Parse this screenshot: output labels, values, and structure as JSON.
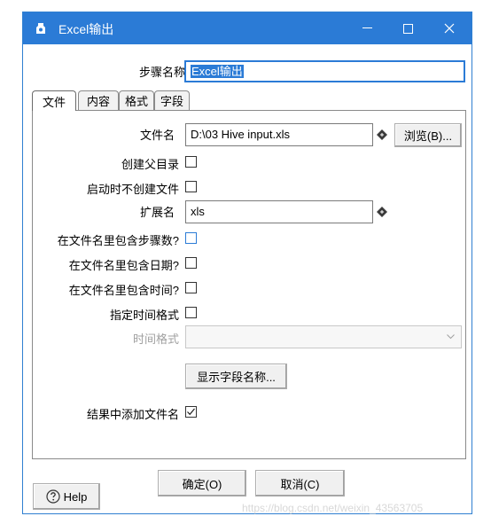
{
  "window": {
    "title": "Excel输出",
    "minimize_glyph": "—",
    "maximize_glyph": "☐",
    "close_glyph": "✕",
    "titlebar_color": "#2b7bd6"
  },
  "step": {
    "label": "步骤名称",
    "value": "Excel输出"
  },
  "tabs": [
    {
      "label": "文件",
      "active": true
    },
    {
      "label": "内容",
      "active": false
    },
    {
      "label": "格式",
      "active": false
    },
    {
      "label": "字段",
      "active": false
    }
  ],
  "file_tab": {
    "filename_label": "文件名",
    "filename_value": "D:\\03 Hive input.xls",
    "browse_button": "浏览(B)...",
    "create_parent_label": "创建父目录",
    "create_parent_checked": false,
    "no_create_on_start_label": "启动时不创建文件",
    "no_create_on_start_checked": false,
    "extension_label": "扩展名",
    "extension_value": "xls",
    "include_stepnr_label": "在文件名里包含步骤数?",
    "include_stepnr_checked": false,
    "include_date_label": "在文件名里包含日期?",
    "include_date_checked": false,
    "include_time_label": "在文件名里包含时间?",
    "include_time_checked": false,
    "specify_format_label": "指定时间格式",
    "specify_format_checked": false,
    "date_format_label": "时间格式",
    "date_format_value": "",
    "show_fields_button": "显示字段名称...",
    "add_to_result_label": "结果中添加文件名",
    "add_to_result_checked": true
  },
  "footer": {
    "help_button": "Help",
    "ok_button": "确定(O)",
    "cancel_button": "取消(C)"
  },
  "watermark": "https://blog.csdn.net/weixin_43563705",
  "icons": {
    "title": "kettle-step-icon",
    "variable": "variable-diamond-icon",
    "help": "question-circle-icon",
    "dropdown": "chevron-down-icon"
  }
}
